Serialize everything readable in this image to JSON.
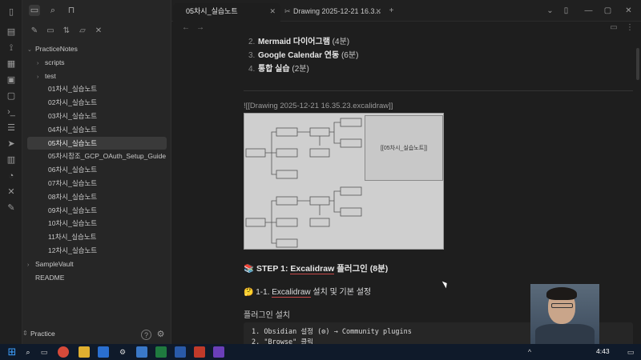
{
  "sidebar": {
    "tree": [
      {
        "label": "PracticeNotes",
        "indent": 0,
        "chevron": "v"
      },
      {
        "label": "scripts",
        "indent": 1,
        "chevron": ">"
      },
      {
        "label": "test",
        "indent": 1,
        "chevron": ">"
      },
      {
        "label": "01차시_실습노트",
        "indent": 2
      },
      {
        "label": "02차시_실습노트",
        "indent": 2
      },
      {
        "label": "03차시_실습노트",
        "indent": 2
      },
      {
        "label": "04차시_실습노트",
        "indent": 2
      },
      {
        "label": "05차시_실습노트",
        "indent": 2,
        "selected": true
      },
      {
        "label": "05차시참조_GCP_OAuth_Setup_Guide",
        "indent": 2
      },
      {
        "label": "06차시_실습노트",
        "indent": 2
      },
      {
        "label": "07차시_실습노트",
        "indent": 2
      },
      {
        "label": "08차시_실습노트",
        "indent": 2
      },
      {
        "label": "09차시_실습노트",
        "indent": 2
      },
      {
        "label": "10차시_실습노트",
        "indent": 2
      },
      {
        "label": "11차시_실습노트",
        "indent": 2
      },
      {
        "label": "12차시_실습노트",
        "indent": 2
      },
      {
        "label": "SampleVault",
        "indent": 0,
        "chevron": ">"
      },
      {
        "label": "README",
        "indent": 0
      }
    ],
    "vault_name": "Practice"
  },
  "tabs": [
    {
      "label": "05차시_실습노트",
      "active": true
    },
    {
      "label": "Drawing 2025-12-21 16.3...",
      "active": false
    }
  ],
  "content": {
    "list": [
      {
        "num": "2.",
        "bold": "Mermaid 다이어그램",
        "dur": " (4분)"
      },
      {
        "num": "3.",
        "bold": "Google Calendar 연동",
        "dur": " (6분)"
      },
      {
        "num": "4.",
        "bold": "통합 실습",
        "dur": " (2분)"
      }
    ],
    "embed_link": "![[Drawing 2025-12-21 16.35.23.excalidraw]]",
    "embed_label": "[[05차시_실습노트]]",
    "step_heading_emoji": "📚",
    "step_heading": "STEP 1: ",
    "step_heading_underlined": "Excalidraw",
    "step_heading_rest": " 플러그인 (8분)",
    "sub_heading_emoji": "🤔",
    "sub_heading_prefix": "1-1. ",
    "sub_heading_underlined": "Excalidraw",
    "sub_heading_rest": " 설치 및 기본 설정",
    "paragraph": "플러그인 설치",
    "code_lines": [
      "1. Obsidian 설정 (⚙) → Community plugins",
      "2. \"Browse\" 클릭"
    ]
  },
  "taskbar": {
    "time": "4:43"
  },
  "colors": {
    "background": "#1e1e1e",
    "sidebar": "#262626",
    "accent_underline": "#c84848",
    "taskbar": "#0f1a2a"
  }
}
